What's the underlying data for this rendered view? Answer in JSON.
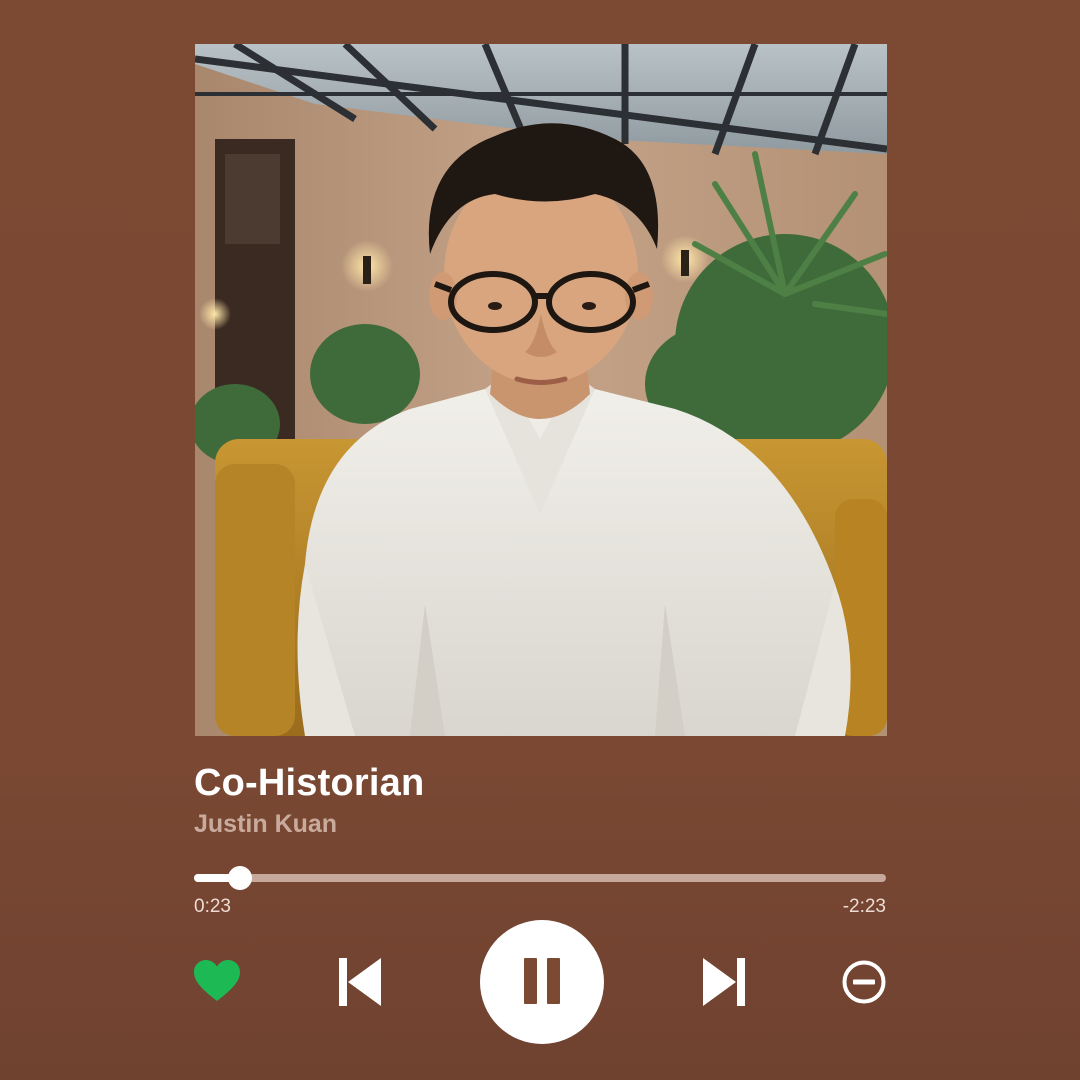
{
  "track": {
    "title": "Co-Historian",
    "artist": "Justin Kuan"
  },
  "playback": {
    "elapsed": "0:23",
    "remaining": "-2:23",
    "progress_fraction": 0.067,
    "state": "playing"
  },
  "controls": {
    "like_icon": "heart-icon",
    "previous_icon": "skip-previous-icon",
    "pause_icon": "pause-icon",
    "next_icon": "skip-next-icon",
    "remove_icon": "remove-circle-icon"
  },
  "colors": {
    "background": "#7c4a33",
    "like_active": "#1db954",
    "track_remaining": "#c7a99b",
    "foreground": "#ffffff",
    "artist_text": "#c9ab9e"
  }
}
